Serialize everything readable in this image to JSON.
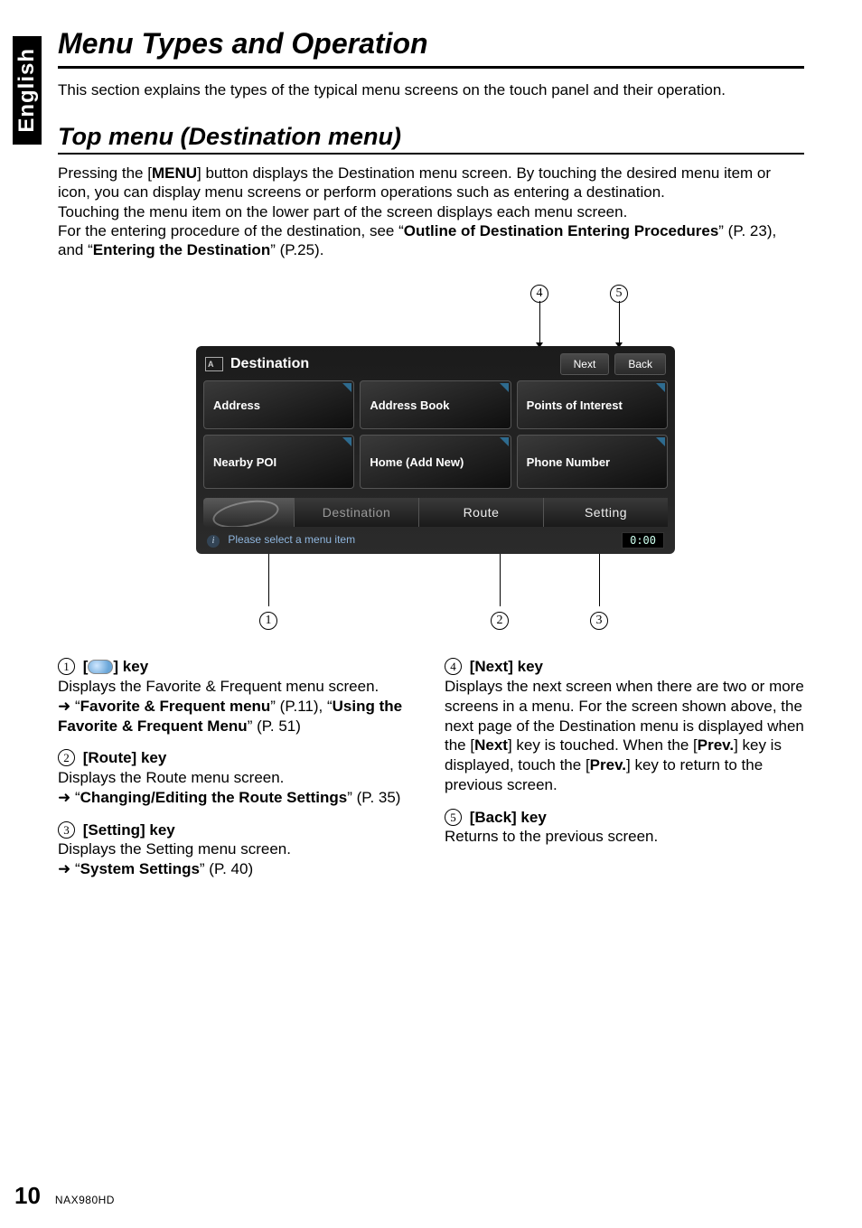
{
  "lang_tab": "English",
  "heading1": "Menu Types and Operation",
  "intro": "This section explains the types of the typical menu screens on the touch panel and their operation.",
  "heading2": "Top menu (Destination menu)",
  "para_parts": {
    "p1a": "Pressing the [",
    "p1b": "MENU",
    "p1c": "] button displays the Destination menu screen. By touching the desired menu item or icon, you can display menu screens or perform operations such as entering a destination.",
    "p2": "Touching the menu item on the lower part of the screen displays each menu screen.",
    "p3a": "For the entering procedure of the destination, see “",
    "p3b": "Outline of Destination Entering Procedures",
    "p3c": "” (P. 23), and “",
    "p3d": "Entering the Destination",
    "p3e": "” (P.25)."
  },
  "callouts": {
    "c1": "1",
    "c2": "2",
    "c3": "3",
    "c4": "4",
    "c5": "5"
  },
  "device": {
    "title": "Destination",
    "next": "Next",
    "back": "Back",
    "buttons": {
      "address": "Address",
      "address_book": "Address Book",
      "poi": "Points of Interest",
      "nearby": "Nearby POI",
      "home": "Home (Add New)",
      "phone": "Phone Number"
    },
    "tabs": {
      "destination": "Destination",
      "route": "Route",
      "setting": "Setting"
    },
    "status_msg": "Please select a menu item",
    "time": "0:00"
  },
  "keys": {
    "k1": {
      "num": "1",
      "title_a": "[",
      "title_b": "] key",
      "line1": "Displays the Favorite & Frequent menu screen.",
      "ref_a": "“",
      "ref_b": "Favorite & Frequent menu",
      "ref_c": "” (P.11), “",
      "ref_d": "Using the Favorite & Frequent Menu",
      "ref_e": "” (P. 51)"
    },
    "k2": {
      "num": "2",
      "title": "[Route] key",
      "line1": "Displays the Route menu screen.",
      "ref_a": "“",
      "ref_b": "Changing/Editing the Route Settings",
      "ref_c": "” (P. 35)"
    },
    "k3": {
      "num": "3",
      "title": "[Setting] key",
      "line1": "Displays the Setting menu screen.",
      "ref_a": "“",
      "ref_b": "System Settings",
      "ref_c": "” (P. 40)"
    },
    "k4": {
      "num": "4",
      "title": "[Next] key",
      "body_a": "Displays the next screen when there are two or more screens in a menu. For the screen shown above, the next page of the Destination menu is displayed when the [",
      "body_b": "Next",
      "body_c": "] key is touched. When the [",
      "body_d": "Prev.",
      "body_e": "] key is displayed, touch the [",
      "body_f": "Prev.",
      "body_g": "] key to return to the previous screen."
    },
    "k5": {
      "num": "5",
      "title": "[Back] key",
      "line1": "Returns to the previous screen."
    }
  },
  "arrow": "➜",
  "footer": {
    "page": "10",
    "model": "NAX980HD"
  }
}
